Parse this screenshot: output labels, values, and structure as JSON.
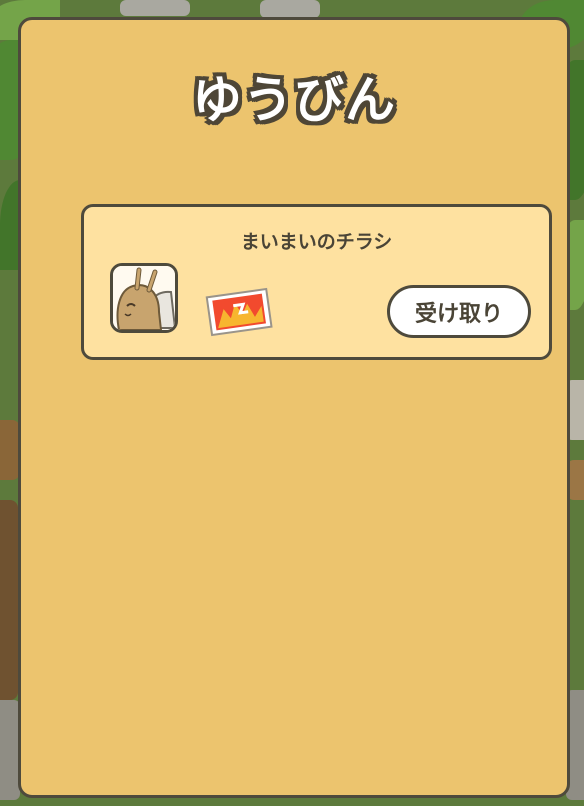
{
  "dialog": {
    "title": "ゆうびん"
  },
  "mail_list": [
    {
      "sender_title": "まいまいのチラシ",
      "sender_icon": "snail-character-icon",
      "item_icon": "flyer-icon",
      "receive_label": "受け取り"
    }
  ],
  "colors": {
    "panel_bg": "#ecc46e",
    "card_bg": "#fee1a0",
    "border": "#4e4a3c",
    "button_bg": "#ffffff"
  }
}
